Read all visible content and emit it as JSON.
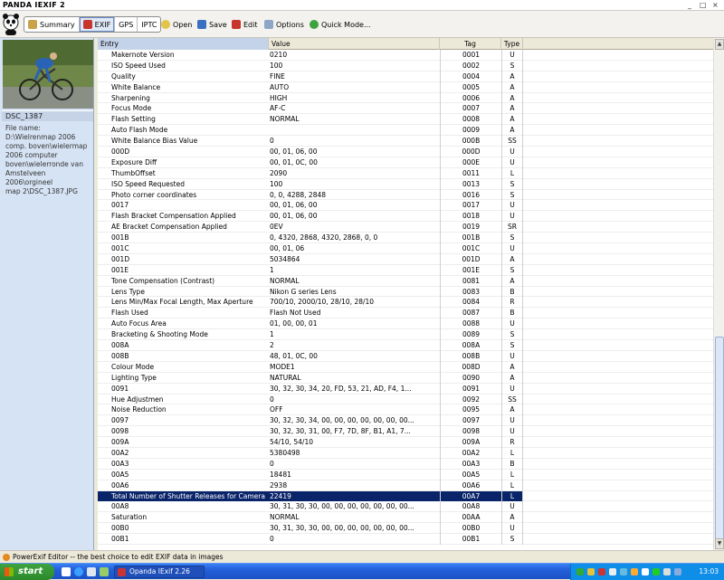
{
  "window": {
    "title": "PANDA IEXIF 2"
  },
  "toolbar": {
    "tabs": [
      {
        "label": "Summary",
        "icon": "summary-icon"
      },
      {
        "label": "EXIF",
        "icon": "exif-icon"
      },
      {
        "label": "GPS"
      },
      {
        "label": "IPTC"
      }
    ],
    "buttons": [
      {
        "label": "Open",
        "icon": "open-icon"
      },
      {
        "label": "Save",
        "icon": "save-icon"
      },
      {
        "label": "Edit",
        "icon": "edit-icon"
      },
      {
        "label": "Options",
        "icon": "options-icon"
      },
      {
        "label": "Quick Mode...",
        "icon": "quick-mode-icon"
      }
    ]
  },
  "sidebar": {
    "filename": "DSC_1387",
    "info": "File name:\nD:\\Wielrenmap 2006\ncomp. boven\\wielermap\n2006 computer\nboven\\wielerronde van\nAmstelveen 2006\\orgineel\nmap 2\\DSC_1387.JPG"
  },
  "table": {
    "headers": {
      "entry": "Entry",
      "value": "Value",
      "tag": "Tag",
      "type": "Type"
    },
    "rows": [
      {
        "entry": "Makernote Version",
        "value": "0210",
        "tag": "0001",
        "type": "U"
      },
      {
        "entry": "ISO Speed Used",
        "value": "100",
        "tag": "0002",
        "type": "S"
      },
      {
        "entry": "Quality",
        "value": "FINE",
        "tag": "0004",
        "type": "A"
      },
      {
        "entry": "White Balance",
        "value": "AUTO",
        "tag": "0005",
        "type": "A"
      },
      {
        "entry": "Sharpening",
        "value": "HIGH",
        "tag": "0006",
        "type": "A"
      },
      {
        "entry": "Focus Mode",
        "value": "AF-C",
        "tag": "0007",
        "type": "A"
      },
      {
        "entry": "Flash Setting",
        "value": "NORMAL",
        "tag": "0008",
        "type": "A"
      },
      {
        "entry": "Auto Flash Mode",
        "value": "",
        "tag": "0009",
        "type": "A"
      },
      {
        "entry": "White Balance Bias Value",
        "value": "0",
        "tag": "000B",
        "type": "SS"
      },
      {
        "entry": "000D",
        "value": "00, 01, 06, 00",
        "tag": "000D",
        "type": "U"
      },
      {
        "entry": "Exposure Diff",
        "value": "00, 01, 0C, 00",
        "tag": "000E",
        "type": "U"
      },
      {
        "entry": "ThumbOffset",
        "value": "2090",
        "tag": "0011",
        "type": "L"
      },
      {
        "entry": "ISO Speed Requested",
        "value": "100",
        "tag": "0013",
        "type": "S"
      },
      {
        "entry": "Photo corner coordinates",
        "value": "0, 0, 4288, 2848",
        "tag": "0016",
        "type": "S"
      },
      {
        "entry": "0017",
        "value": "00, 01, 06, 00",
        "tag": "0017",
        "type": "U"
      },
      {
        "entry": "Flash Bracket Compensation Applied",
        "value": "00, 01, 06, 00",
        "tag": "0018",
        "type": "U"
      },
      {
        "entry": "AE Bracket Compensation Applied",
        "value": "0EV",
        "tag": "0019",
        "type": "SR"
      },
      {
        "entry": "001B",
        "value": "0, 4320, 2868, 4320, 2868, 0, 0",
        "tag": "001B",
        "type": "S"
      },
      {
        "entry": "001C",
        "value": "00, 01, 06",
        "tag": "001C",
        "type": "U"
      },
      {
        "entry": "001D",
        "value": "5034864",
        "tag": "001D",
        "type": "A"
      },
      {
        "entry": "001E",
        "value": "1",
        "tag": "001E",
        "type": "S"
      },
      {
        "entry": "Tone Compensation (Contrast)",
        "value": "NORMAL",
        "tag": "0081",
        "type": "A"
      },
      {
        "entry": "Lens Type",
        "value": "Nikon G series Lens",
        "tag": "0083",
        "type": "B"
      },
      {
        "entry": "Lens Min/Max Focal Length, Max Aperture",
        "value": "700/10, 2000/10, 28/10, 28/10",
        "tag": "0084",
        "type": "R"
      },
      {
        "entry": "Flash Used",
        "value": "Flash Not Used",
        "tag": "0087",
        "type": "B"
      },
      {
        "entry": "Auto Focus Area",
        "value": "01, 00, 00, 01",
        "tag": "0088",
        "type": "U"
      },
      {
        "entry": "Bracketing & Shooting Mode",
        "value": "1",
        "tag": "0089",
        "type": "S"
      },
      {
        "entry": "008A",
        "value": "2",
        "tag": "008A",
        "type": "S"
      },
      {
        "entry": "008B",
        "value": "48, 01, 0C, 00",
        "tag": "008B",
        "type": "U"
      },
      {
        "entry": "Colour Mode",
        "value": "MODE1",
        "tag": "008D",
        "type": "A"
      },
      {
        "entry": "Lighting Type",
        "value": "NATURAL",
        "tag": "0090",
        "type": "A"
      },
      {
        "entry": "0091",
        "value": "30, 32, 30, 34, 20, FD, 53, 21, AD, F4, 1...",
        "tag": "0091",
        "type": "U"
      },
      {
        "entry": "Hue Adjustmen",
        "value": "0",
        "tag": "0092",
        "type": "SS"
      },
      {
        "entry": "Noise Reduction",
        "value": "OFF",
        "tag": "0095",
        "type": "A"
      },
      {
        "entry": "0097",
        "value": "30, 32, 30, 34, 00, 00, 00, 00, 00, 00, 00...",
        "tag": "0097",
        "type": "U"
      },
      {
        "entry": "0098",
        "value": "30, 32, 30, 31, 00, F7, 7D, 8F, B1, A1, 7...",
        "tag": "0098",
        "type": "U"
      },
      {
        "entry": "009A",
        "value": "54/10, 54/10",
        "tag": "009A",
        "type": "R"
      },
      {
        "entry": "00A2",
        "value": "5380498",
        "tag": "00A2",
        "type": "L"
      },
      {
        "entry": "00A3",
        "value": "0",
        "tag": "00A3",
        "type": "B"
      },
      {
        "entry": "00A5",
        "value": "18481",
        "tag": "00A5",
        "type": "L"
      },
      {
        "entry": "00A6",
        "value": "2938",
        "tag": "00A6",
        "type": "L"
      },
      {
        "entry": "Total Number of Shutter Releases for Camera",
        "value": "22419",
        "tag": "00A7",
        "type": "L",
        "selected": true
      },
      {
        "entry": "00A8",
        "value": "30, 31, 30, 30, 00, 00, 00, 00, 00, 00, 00...",
        "tag": "00A8",
        "type": "U"
      },
      {
        "entry": "Saturation",
        "value": "NORMAL",
        "tag": "00AA",
        "type": "A"
      },
      {
        "entry": "00B0",
        "value": "30, 31, 30, 30, 00, 00, 00, 00, 00, 00, 00...",
        "tag": "00B0",
        "type": "U"
      },
      {
        "entry": "00B1",
        "value": "0",
        "tag": "00B1",
        "type": "S"
      }
    ]
  },
  "status": {
    "text": "PowerExif Editor -- the best choice to edit EXIF data in images"
  },
  "taskbar": {
    "start_label": "start",
    "task_label": "Opanda IExif 2.26",
    "clock": "13:03"
  },
  "colors": {
    "selection": "#0a246a",
    "taskbar": "#245edb",
    "start_button": "#3a9a3a"
  }
}
